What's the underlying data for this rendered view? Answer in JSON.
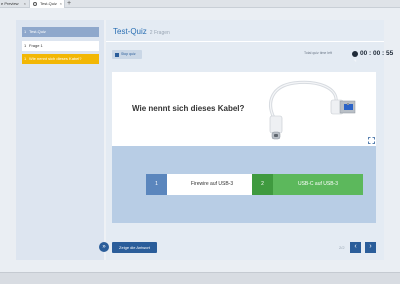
{
  "browser": {
    "tabs": [
      {
        "label": "e Preview",
        "close": "×"
      },
      {
        "label": "Test-Quiz",
        "close": "×"
      }
    ],
    "new_tab": "+"
  },
  "sidebar": {
    "items": [
      {
        "num": "1",
        "label": "Test-Quiz"
      },
      {
        "num": "1",
        "label": "Frage 1"
      },
      {
        "num": "1",
        "label": "Wie nennt sich dieses Kabel?"
      }
    ]
  },
  "quiz": {
    "title": "Test-Quiz",
    "subtitle": "2 Fragen",
    "stop_label": "Stop quiz",
    "time_label": "Total quiz time left",
    "timer": "00 : 00 : 55",
    "question": "Wie nennt sich dieses Kabel?",
    "answers": [
      {
        "num": "1",
        "label": "Firewire auf USB-3"
      },
      {
        "num": "2",
        "label": "USB-C auf USB-3"
      }
    ],
    "show_answer": "Zeige die Antwort",
    "pager": "2/2",
    "collapse_icon": "»",
    "prev_icon": "‹",
    "next_icon": "›"
  },
  "colors": {
    "accent": "#2a5d9a",
    "highlight": "#f2b705",
    "correct": "#5cb85c"
  }
}
